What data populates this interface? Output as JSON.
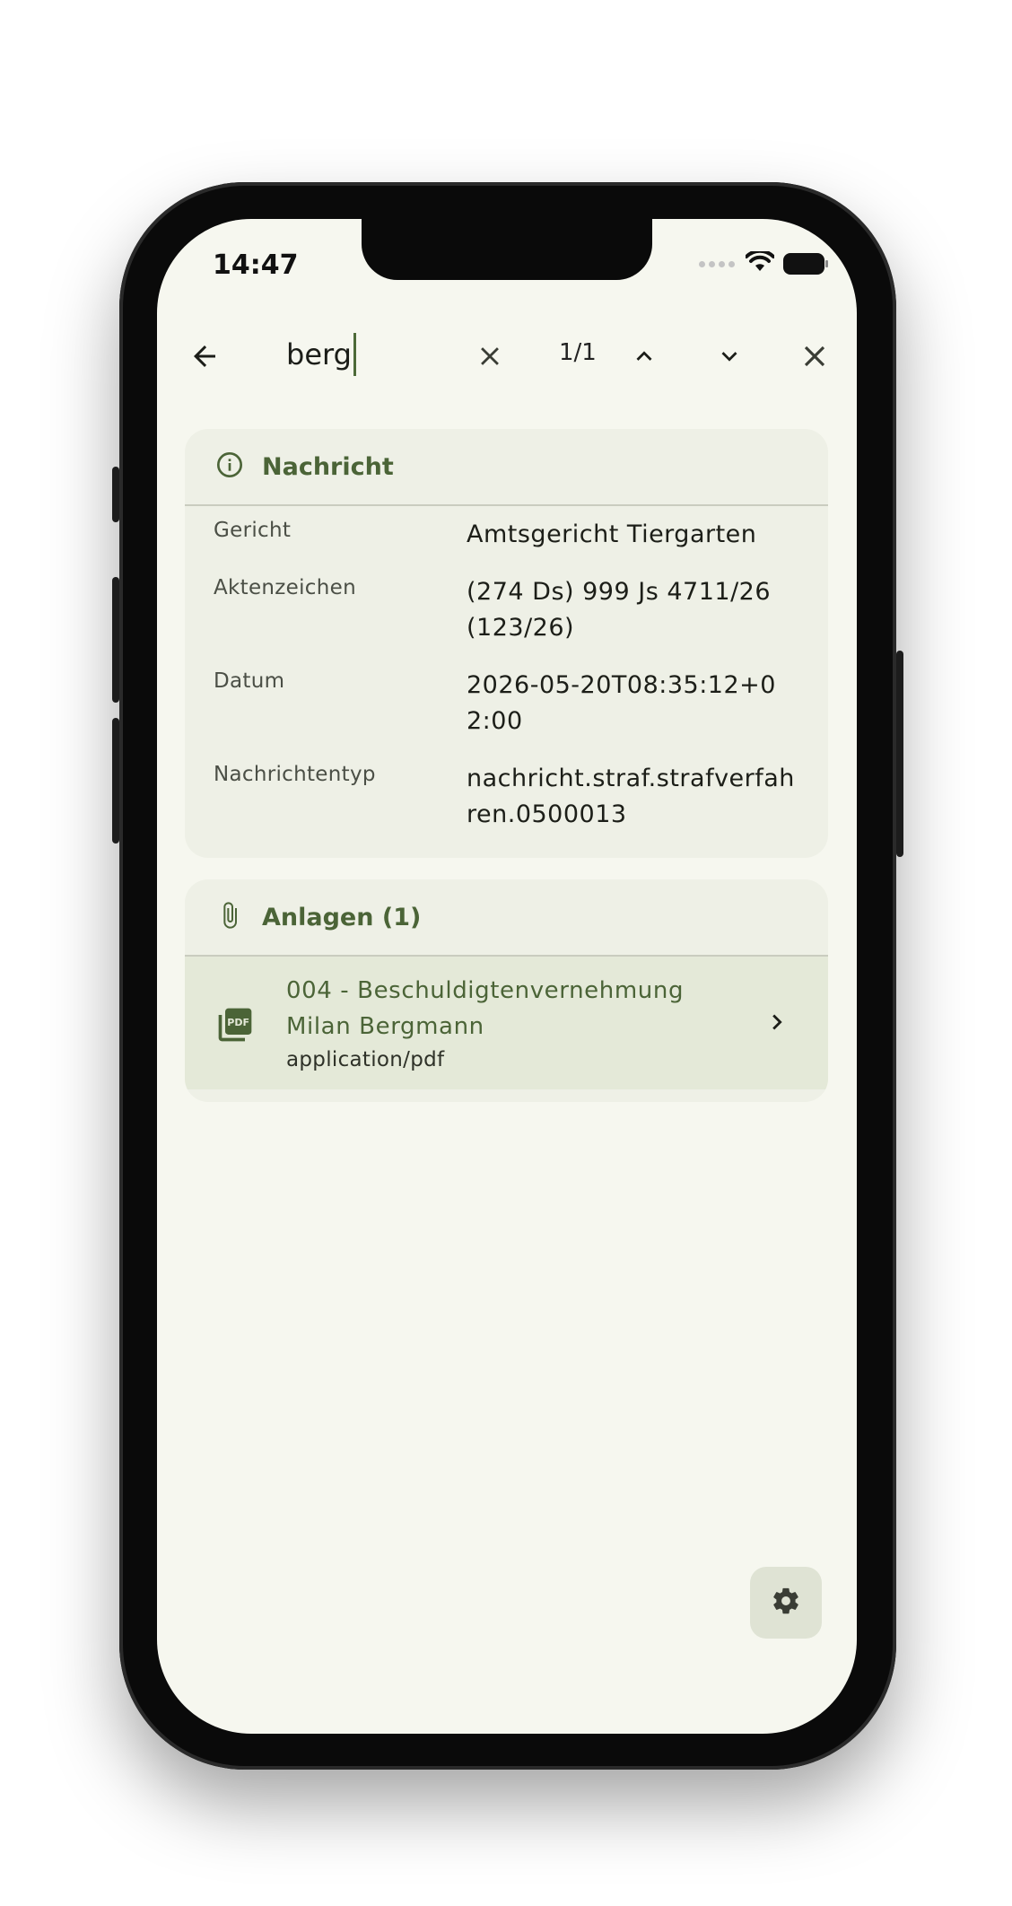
{
  "status": {
    "time": "14:47"
  },
  "search": {
    "query": "berg",
    "counter": "1/1"
  },
  "message": {
    "title": "Nachricht",
    "fields": [
      {
        "label": "Gericht",
        "value": "Amtsgericht Tiergarten"
      },
      {
        "label": "Aktenzeichen",
        "value": "(274 Ds) 999 Js 4711/26 (123/26)"
      },
      {
        "label": "Datum",
        "value": "2026-05-20T08:35:12+02:00"
      },
      {
        "label": "Nachrichtentyp",
        "value": "nachricht.straf.strafverfahren.0500013"
      }
    ]
  },
  "attachments": {
    "title": "Anlagen (1)",
    "items": [
      {
        "line1": "004 - Beschuldigtenvernehmung",
        "line2": "Milan Bergmann",
        "mime": "application/pdf",
        "icon": "pdf-icon"
      }
    ]
  },
  "colors": {
    "accent": "#4b6437",
    "background": "#f6f7ef",
    "card": "#eef0e6",
    "selected_row": "#e4e9d8"
  },
  "icons": [
    "back-arrow-icon",
    "clear-icon",
    "chevron-up-icon",
    "chevron-down-icon",
    "close-icon",
    "info-icon",
    "paperclip-icon",
    "pdf-icon",
    "chevron-right-icon",
    "gear-icon",
    "wifi-icon",
    "battery-icon"
  ]
}
